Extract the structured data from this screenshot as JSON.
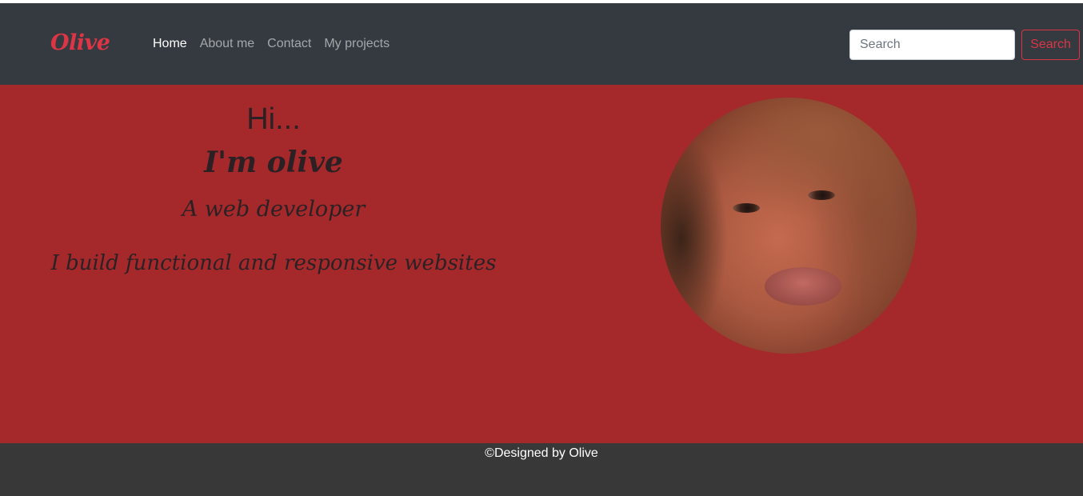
{
  "navbar": {
    "brand": "Olive",
    "links": [
      {
        "label": "Home",
        "active": true
      },
      {
        "label": "About me",
        "active": false
      },
      {
        "label": "Contact",
        "active": false
      },
      {
        "label": "My projects",
        "active": false
      }
    ],
    "search": {
      "placeholder": "Search",
      "value": "",
      "button_label": "Search"
    }
  },
  "hero": {
    "greeting": "Hi...",
    "name": "I'm olive",
    "role": "A web developer",
    "tagline": "I build functional and responsive websites"
  },
  "footer": {
    "text": "©Designed by Olive"
  },
  "colors": {
    "navbar_bg": "#343a40",
    "brand": "#dc3545",
    "hero_bg": "#a5292a",
    "footer_bg": "#383838"
  }
}
